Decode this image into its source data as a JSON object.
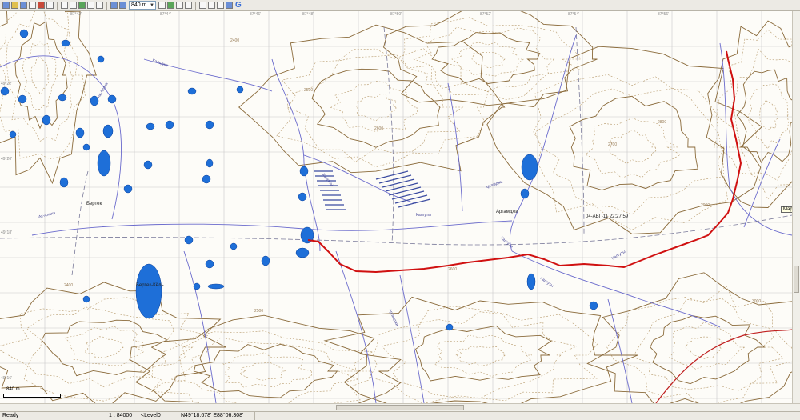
{
  "toolbar": {
    "scale_value": "840 m",
    "icons": [
      "new-icon",
      "open-icon",
      "save-icon",
      "print-icon",
      "copy-icon",
      "paste-icon",
      "pan-icon",
      "select-icon",
      "track-icon",
      "waypoint-icon",
      "measure-icon",
      "zoom-in-icon",
      "zoom-out-icon",
      "zoom-extent-icon",
      "search-icon",
      "layers-icon",
      "grid-icon",
      "undo-icon",
      "redo-icon",
      "cut-icon",
      "globe-icon"
    ],
    "google_label": "G"
  },
  "map": {
    "grid_top_labels": [
      "87°42'",
      "87°44'",
      "87°46'",
      "87°48'",
      "87°50'",
      "87°52'",
      "87°54'",
      "87°56'"
    ],
    "grid_left_labels": [
      "49°22'",
      "49°20'",
      "49°18'",
      "49°16'"
    ],
    "place_labels": [
      {
        "text": "Ак-Алаха",
        "kind": "river"
      },
      {
        "text": "Кальдже",
        "kind": "river"
      },
      {
        "text": "Бертек",
        "kind": "place"
      },
      {
        "text": "Ак-Алаха",
        "kind": "river"
      },
      {
        "text": "Бертек-Кёль",
        "kind": "place"
      },
      {
        "text": "Калгуты",
        "kind": "river"
      },
      {
        "text": "Аргамджи",
        "kind": "river"
      },
      {
        "text": "Аргамджи",
        "kind": "place"
      },
      {
        "text": "Калгуты",
        "kind": "river"
      },
      {
        "text": "Калгуты",
        "kind": "river"
      },
      {
        "text": "Калгуты",
        "kind": "river"
      },
      {
        "text": "04-АВГ-11 22:27:59",
        "kind": "place"
      },
      {
        "text": "Калгуты",
        "kind": "river"
      },
      {
        "text": "Аргамджи",
        "kind": "river"
      }
    ],
    "contour_labels": [
      "2400",
      "2500",
      "2600",
      "2700",
      "2800",
      "2900",
      "3000",
      "2400",
      "2500",
      "2600"
    ],
    "tooltip": "Map cov",
    "scale_bar_label": "840 m"
  },
  "status": {
    "ready": "Ready",
    "scale": "1 : 84000",
    "level": "<Level0",
    "coords": "N49°18.678' E88°06.308'"
  },
  "colors": {
    "track": "#d01010",
    "water": "#1e6fd8",
    "river": "#6a6acc",
    "contour": "#b79a6c",
    "index_contour": "#8a6a3a",
    "border": "#c02020",
    "grid": "#b8b8b8"
  }
}
